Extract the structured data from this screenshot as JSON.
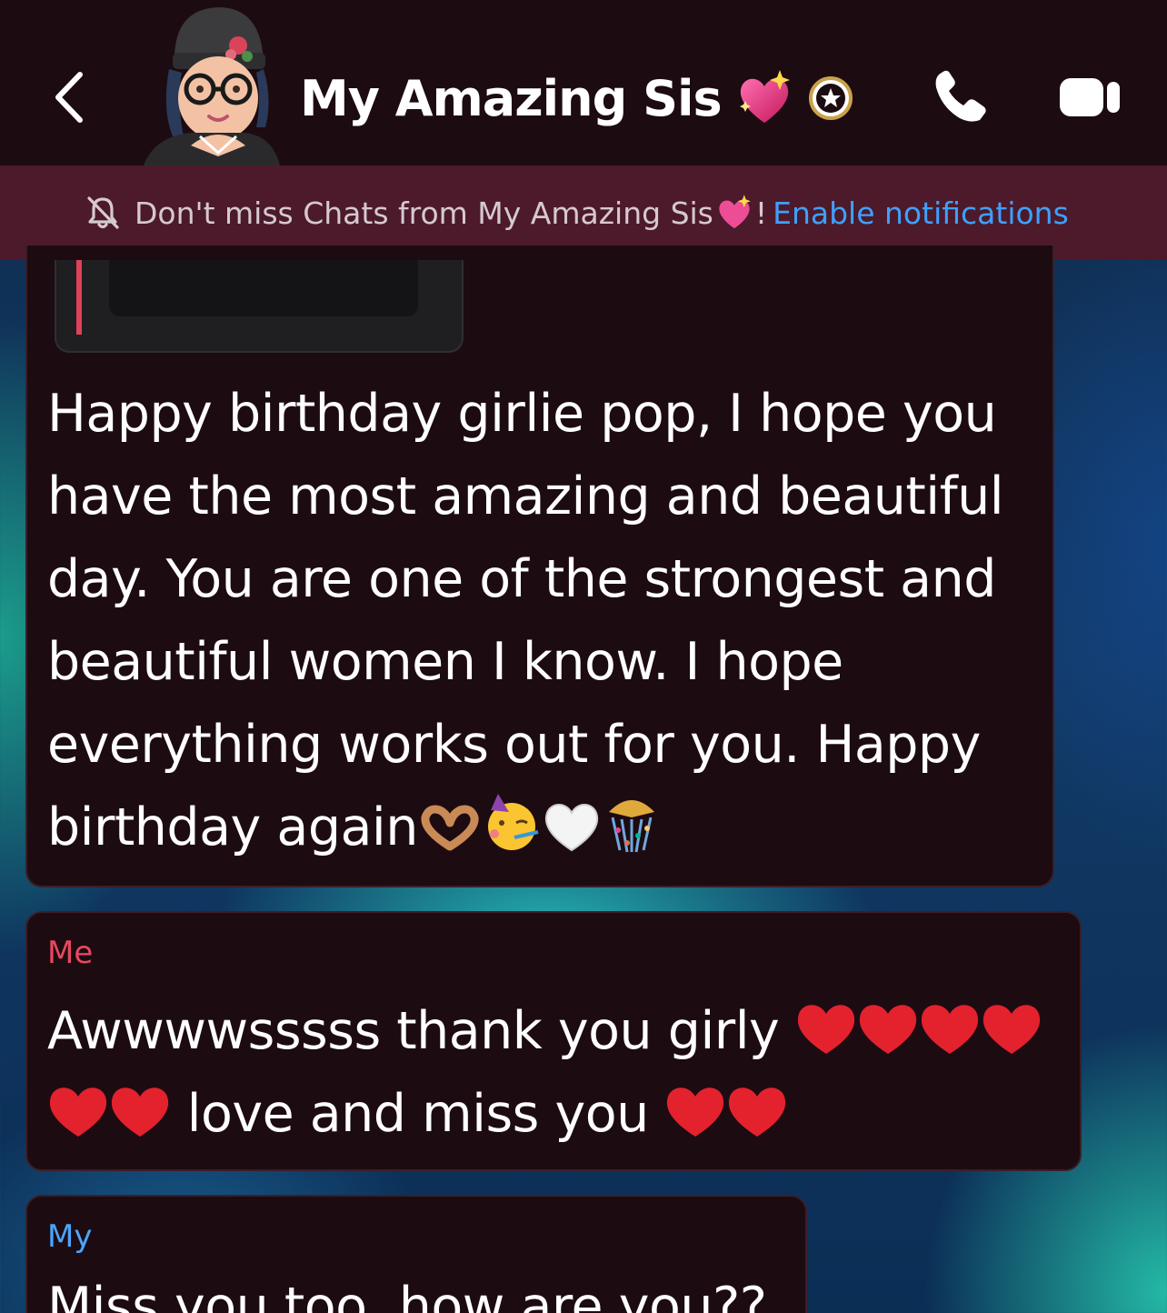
{
  "header": {
    "title": "My Amazing Sis",
    "title_emoji": "sparkling-heart",
    "badge": "star-badge",
    "actions": [
      "call",
      "video-call"
    ]
  },
  "notification": {
    "text_before": "Don't miss Chats from My Amazing Sis",
    "text_after": "!",
    "link": "Enable notifications",
    "link_color": "#3ea0ff"
  },
  "messages": [
    {
      "snap_status": "Opened",
      "text_lines": [
        "Happy birthday girlie pop, I hope you",
        "have the most amazing and beautiful",
        "day. You are one of the strongest and",
        "beautiful women I know. I hope",
        "everything works out for you. Happy",
        "birthday again"
      ],
      "trailing_emojis": [
        "heart-hands",
        "partying-face",
        "white-heart",
        "confetti-ball"
      ]
    },
    {
      "sender": "Me",
      "sender_color": "#e8485e",
      "line1": "Awwwwsssss thank you girly",
      "line2": "love and miss you"
    },
    {
      "sender": "My",
      "sender_color": "#4aa6ff",
      "text": "Miss you too, how are you??"
    }
  ],
  "colors": {
    "header_bg": "#1d0b12",
    "banner_bg": "#4c1a2b",
    "bubble_bg": "#1d0b12"
  }
}
